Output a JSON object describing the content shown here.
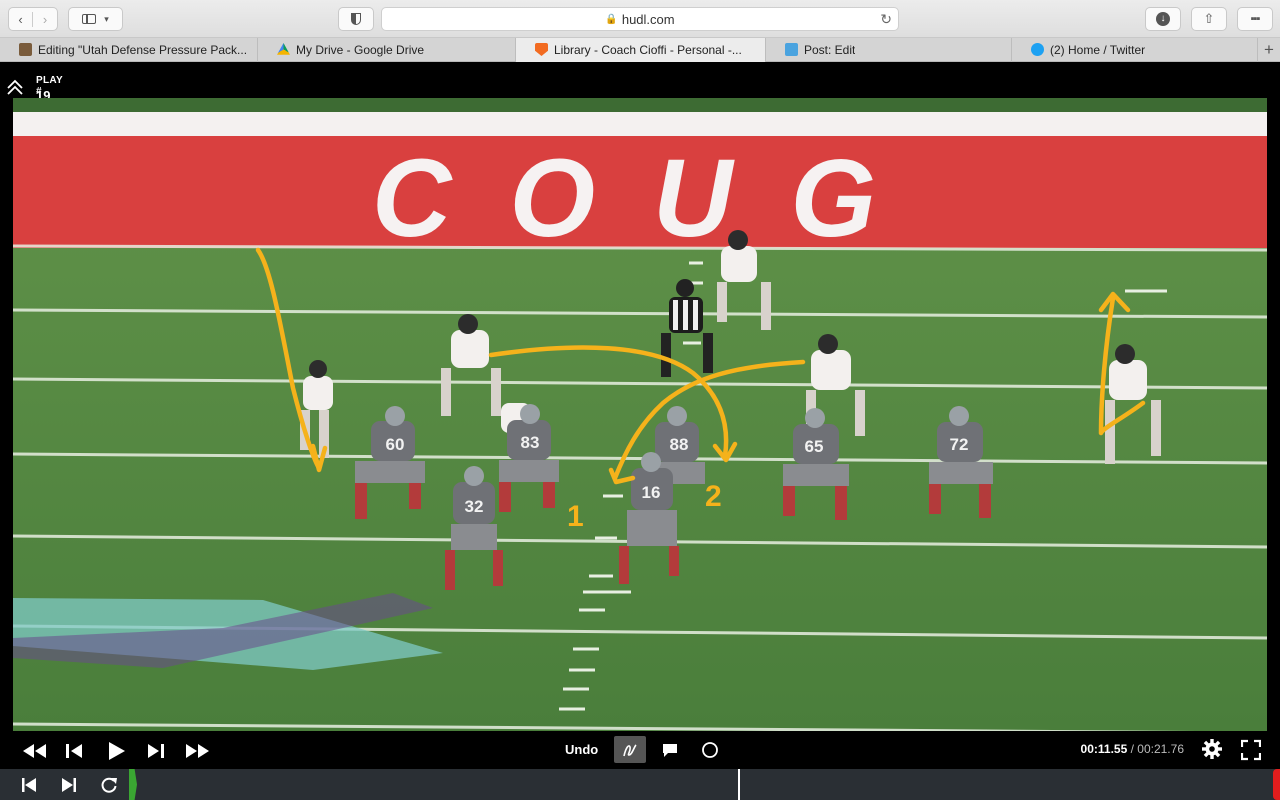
{
  "browser": {
    "url": "hudl.com",
    "tabs": [
      {
        "title": "Editing \"Utah Defense Pressure Pack...",
        "favicon_color": "#7a5c3c",
        "active": false
      },
      {
        "title": "My Drive - Google Drive",
        "favicon_color": "#f4b400",
        "active": false
      },
      {
        "title": "Library - Coach Cioffi - Personal -...",
        "favicon_color": "#f26b21",
        "active": true
      },
      {
        "title": "Post: Edit",
        "favicon_color": "#4aa3df",
        "active": false
      },
      {
        "title": "(2) Home / Twitter",
        "favicon_color": "#1da1f2",
        "active": false
      }
    ]
  },
  "player": {
    "play_label": "PLAY #",
    "play_number": "19",
    "video": {
      "endzone_text": "COUG",
      "telestration_labels": [
        "1",
        "2"
      ],
      "jersey_numbers": [
        "60",
        "83",
        "88",
        "65",
        "72",
        "32",
        "16"
      ]
    },
    "controls": {
      "undo_label": "Undo",
      "current_time": "00:11.55",
      "separator": " / ",
      "total_time": "00:21.76"
    }
  },
  "colors": {
    "accent_telestration": "#f5b21b",
    "field_green": "#4f8240",
    "endzone_red": "#d9403f",
    "timeline_bg": "#2a2f34",
    "marker_green": "#3aa632",
    "marker_red": "#e21d1d"
  }
}
